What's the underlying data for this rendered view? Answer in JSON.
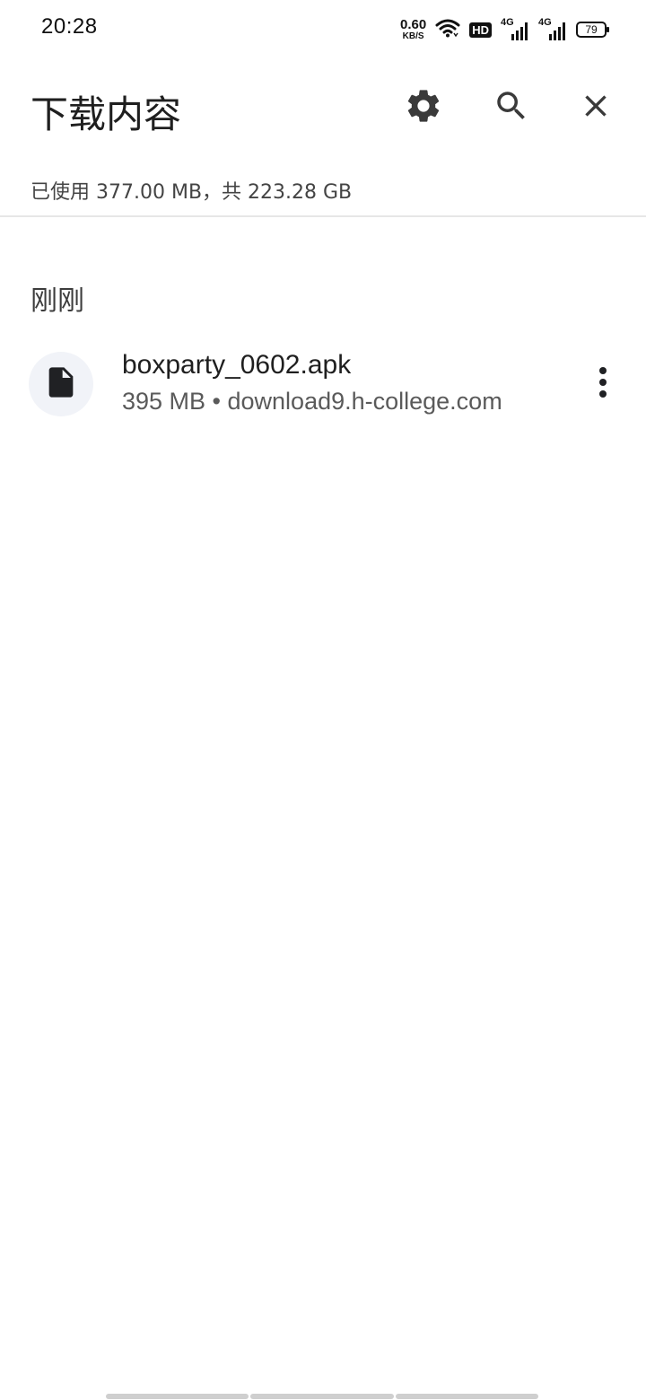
{
  "status_bar": {
    "time": "20:28",
    "net_speed_value": "0.60",
    "net_speed_unit": "KB/S",
    "hd_label": "HD",
    "signal1_label": "4G",
    "signal2_label": "4G",
    "battery_level": "79"
  },
  "app_bar": {
    "title": "下载内容",
    "icons": [
      "gear-icon",
      "search-icon",
      "close-icon"
    ]
  },
  "storage_info": "已使用 377.00 MB，共 223.28 GB",
  "sections": [
    {
      "header": "刚刚",
      "items": [
        {
          "file_name": "boxparty_0602.apk",
          "meta": "395 MB • download9.h-college.com",
          "icon": "file-icon"
        }
      ]
    }
  ]
}
